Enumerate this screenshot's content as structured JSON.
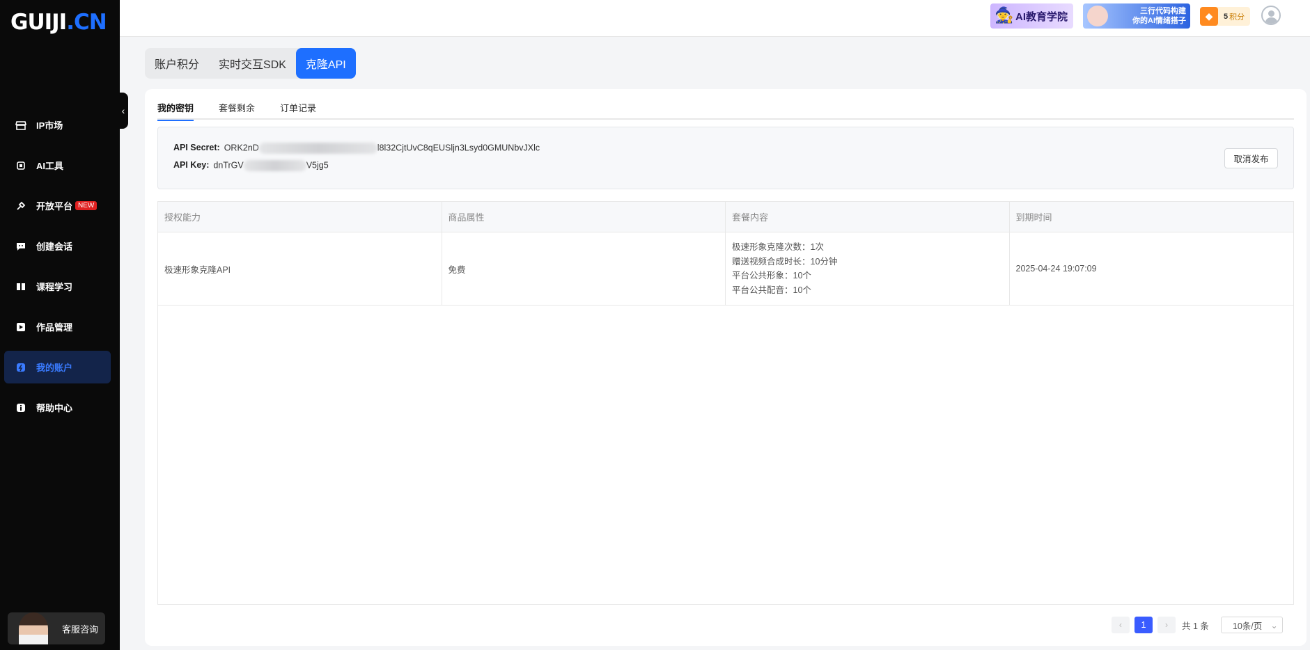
{
  "logo": {
    "main": "GUIJI",
    "accent": ".CN"
  },
  "sidebar": {
    "items": [
      {
        "label": "IP市场",
        "icon": "store-icon"
      },
      {
        "label": "AI工具",
        "icon": "chip-icon"
      },
      {
        "label": "开放平台",
        "icon": "link-icon",
        "badge": "NEW"
      },
      {
        "label": "创建会话",
        "icon": "chat-icon"
      },
      {
        "label": "课程学习",
        "icon": "book-icon"
      },
      {
        "label": "作品管理",
        "icon": "film-icon"
      },
      {
        "label": "我的账户",
        "icon": "account-icon",
        "active": true
      },
      {
        "label": "帮助中心",
        "icon": "info-icon"
      }
    ],
    "service_label": "客服咨询"
  },
  "header": {
    "banner1_text": "AI教育学院",
    "banner2_line1": "三行代码构建",
    "banner2_line2": "你的AI情绪搭子",
    "points_value": "5",
    "points_unit": "积分"
  },
  "main_tabs": [
    {
      "label": "账户积分"
    },
    {
      "label": "实时交互SDK"
    },
    {
      "label": "克隆API",
      "active": true
    }
  ],
  "sub_tabs": [
    {
      "label": "我的密钥",
      "active": true
    },
    {
      "label": "套餐剩余"
    },
    {
      "label": "订单记录"
    }
  ],
  "keys": {
    "secret_label": "API Secret:",
    "secret_prefix": "ORK2nD",
    "secret_suffix": "l8l32CjtUvC8qEUSljn3Lsyd0GMUNbvJXlc",
    "key_label": "API Key:",
    "key_prefix": "dnTrGV",
    "key_suffix": "V5jg5",
    "cancel_button": "取消发布"
  },
  "table": {
    "headers": [
      "授权能力",
      "商品属性",
      "套餐内容",
      "到期时间"
    ],
    "rows": [
      {
        "capability": "极速形象克隆API",
        "attribute": "免费",
        "content": [
          "极速形象克隆次数：1次",
          "赠送视频合成时长：10分钟",
          "平台公共形象：10个",
          "平台公共配音：10个"
        ],
        "expiry": "2025-04-24 19:07:09"
      }
    ]
  },
  "pagination": {
    "current": "1",
    "total_text": "共 1 条",
    "page_size": "10条/页"
  },
  "colors": {
    "accent": "#1e6fff",
    "sidebar_bg": "#0a0a0a",
    "new_badge": "#e02020"
  }
}
